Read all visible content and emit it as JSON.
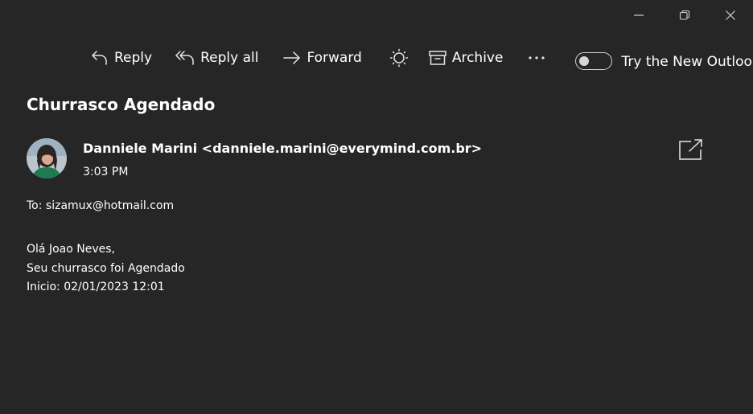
{
  "window": {
    "controls": [
      "minimize",
      "restore",
      "close"
    ]
  },
  "toolbar": {
    "reply_label": "Reply",
    "reply_all_label": "Reply all",
    "forward_label": "Forward",
    "archive_label": "Archive",
    "new_outlook_label": "Try the New Outlook",
    "new_outlook_enabled": false
  },
  "message": {
    "subject": "Churrasco Agendado",
    "sender_name": "Danniele Marini",
    "sender_email": "<danniele.marini@everymind.com.br>",
    "time": "3:03 PM",
    "to_line": "To: sizamux@hotmail.com",
    "body_lines": [
      "Olá Joao Neves,",
      "Seu churrasco foi Agendado",
      "Inicio: 02/01/2023 12:01"
    ]
  },
  "icons": {
    "reply": "reply-icon",
    "reply_all": "reply-all-icon",
    "forward": "forward-icon",
    "theme": "sun-icon",
    "archive": "archive-icon",
    "more": "more-icon",
    "popout": "popout-icon"
  },
  "colors": {
    "background": "#262626",
    "text": "#ffffff",
    "icon": "#e6e6e6"
  }
}
